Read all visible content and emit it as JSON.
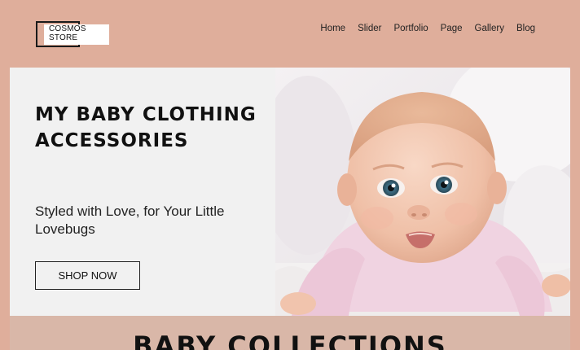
{
  "brand": {
    "logo_text": "COSMOS STORE"
  },
  "nav": {
    "items": [
      "Home",
      "Slider",
      "Portfolio",
      "Page",
      "Gallery",
      "Blog"
    ]
  },
  "hero": {
    "title": "MY BABY CLOTHING ACCESSORIES",
    "subtitle": "Styled with Love, for Your Little Lovebugs",
    "cta_label": "SHOP NOW",
    "image_subject": "baby lying on white fluffy blanket"
  },
  "collections": {
    "title": "BABY COLLECTIONS"
  },
  "colors": {
    "page_bg": "#dfae9b",
    "hero_panel": "#f1f1f1",
    "collections_bg": "#d9b7a8",
    "text": "#111111"
  }
}
